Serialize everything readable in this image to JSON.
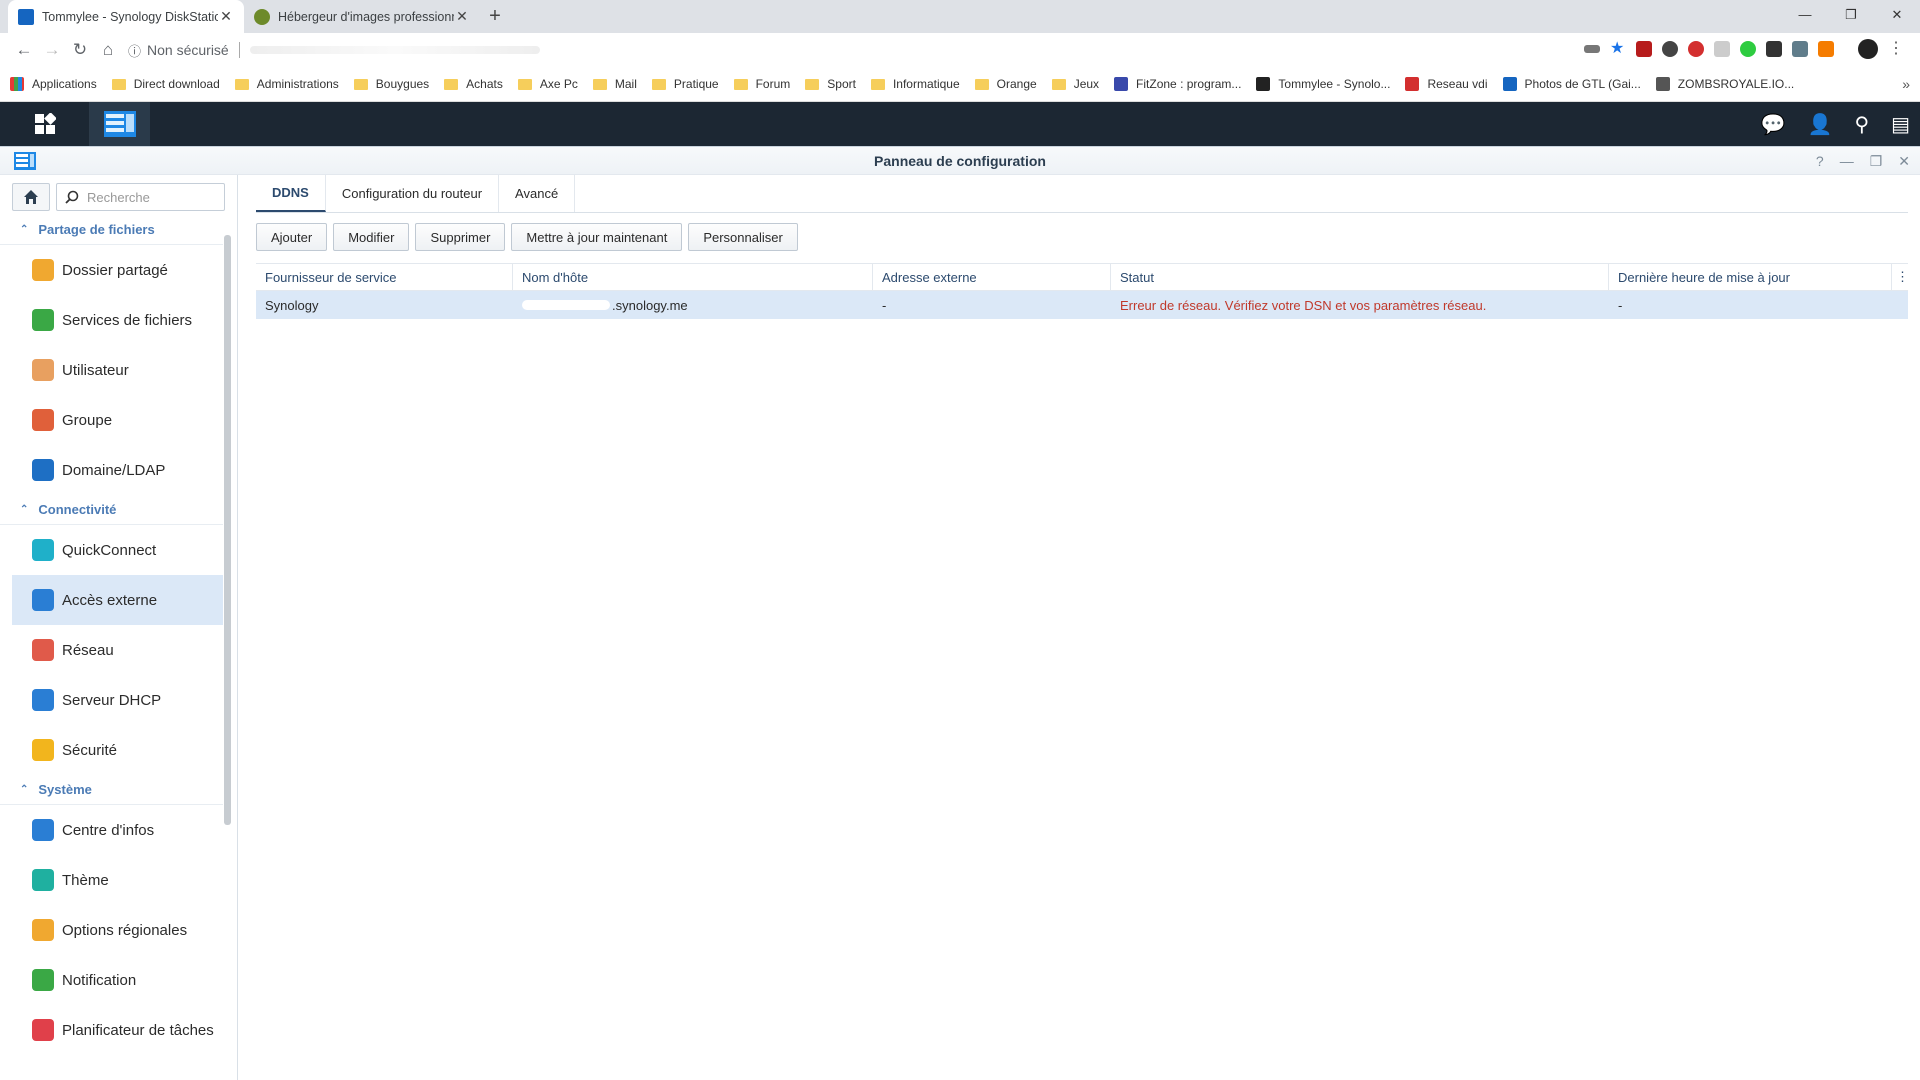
{
  "browser": {
    "tabs": [
      {
        "title": "Tommylee - Synology DiskStation",
        "active": true,
        "favicon_color": "#1565c0"
      },
      {
        "title": "Hébergeur d'images professionnel",
        "active": false,
        "favicon_color": "#6d8a2a"
      }
    ],
    "address": {
      "security_label": "Non sécurisé"
    },
    "bookmarks": [
      {
        "label": "Applications",
        "type": "apps"
      },
      {
        "label": "Direct download",
        "type": "folder"
      },
      {
        "label": "Administrations",
        "type": "folder"
      },
      {
        "label": "Bouygues",
        "type": "folder"
      },
      {
        "label": "Achats",
        "type": "folder"
      },
      {
        "label": "Axe Pc",
        "type": "folder"
      },
      {
        "label": "Mail",
        "type": "folder"
      },
      {
        "label": "Pratique",
        "type": "folder"
      },
      {
        "label": "Forum",
        "type": "folder"
      },
      {
        "label": "Sport",
        "type": "folder"
      },
      {
        "label": "Informatique",
        "type": "folder"
      },
      {
        "label": "Orange",
        "type": "folder"
      },
      {
        "label": "Jeux",
        "type": "folder"
      },
      {
        "label": "FitZone : program...",
        "type": "link"
      },
      {
        "label": "Tommylee - Synolo...",
        "type": "link"
      },
      {
        "label": "Reseau vdi",
        "type": "link"
      },
      {
        "label": "Photos de GTL (Gai...",
        "type": "link"
      },
      {
        "label": "ZOMBSROYALE.IO...",
        "type": "link"
      }
    ]
  },
  "window": {
    "title": "Panneau de configuration"
  },
  "sidebar": {
    "search_placeholder": "Recherche",
    "sections": [
      {
        "label": "Partage de fichiers",
        "items": [
          {
            "label": "Dossier partagé",
            "icon": "folder-share-icon",
            "color": "#f0a830"
          },
          {
            "label": "Services de fichiers",
            "icon": "file-services-icon",
            "color": "#3aa845"
          },
          {
            "label": "Utilisateur",
            "icon": "user-icon",
            "color": "#e8a060"
          },
          {
            "label": "Groupe",
            "icon": "group-icon",
            "color": "#e0603a"
          },
          {
            "label": "Domaine/LDAP",
            "icon": "domain-icon",
            "color": "#1e6fc4"
          }
        ]
      },
      {
        "label": "Connectivité",
        "items": [
          {
            "label": "QuickConnect",
            "icon": "quickconnect-icon",
            "color": "#1fb0c9"
          },
          {
            "label": "Accès externe",
            "icon": "external-access-icon",
            "color": "#2a7ed4",
            "selected": true
          },
          {
            "label": "Réseau",
            "icon": "network-icon",
            "color": "#e05a4a"
          },
          {
            "label": "Serveur DHCP",
            "icon": "dhcp-icon",
            "color": "#2a7ed4"
          },
          {
            "label": "Sécurité",
            "icon": "security-icon",
            "color": "#f2b51d"
          }
        ]
      },
      {
        "label": "Système",
        "items": [
          {
            "label": "Centre d'infos",
            "icon": "info-icon",
            "color": "#2a7ed4"
          },
          {
            "label": "Thème",
            "icon": "theme-icon",
            "color": "#1fb0a0"
          },
          {
            "label": "Options régionales",
            "icon": "regional-icon",
            "color": "#f0a830"
          },
          {
            "label": "Notification",
            "icon": "notification-icon",
            "color": "#3aa845"
          },
          {
            "label": "Planificateur de tâches",
            "icon": "task-scheduler-icon",
            "color": "#e0404a"
          }
        ]
      }
    ]
  },
  "content": {
    "tabs": [
      "DDNS",
      "Configuration du routeur",
      "Avancé"
    ],
    "active_tab": "DDNS",
    "toolbar": {
      "add": "Ajouter",
      "edit": "Modifier",
      "delete": "Supprimer",
      "update_now": "Mettre à jour maintenant",
      "customize": "Personnaliser"
    },
    "columns": [
      "Fournisseur de service",
      "Nom d'hôte",
      "Adresse externe",
      "Statut",
      "Dernière heure de mise à jour"
    ],
    "rows": [
      {
        "provider": "Synology",
        "hostname": ".synology.me",
        "external_address": "-",
        "status": "Erreur de réseau. Vérifiez votre DSN et vos paramètres réseau.",
        "last_update": "-"
      }
    ]
  }
}
